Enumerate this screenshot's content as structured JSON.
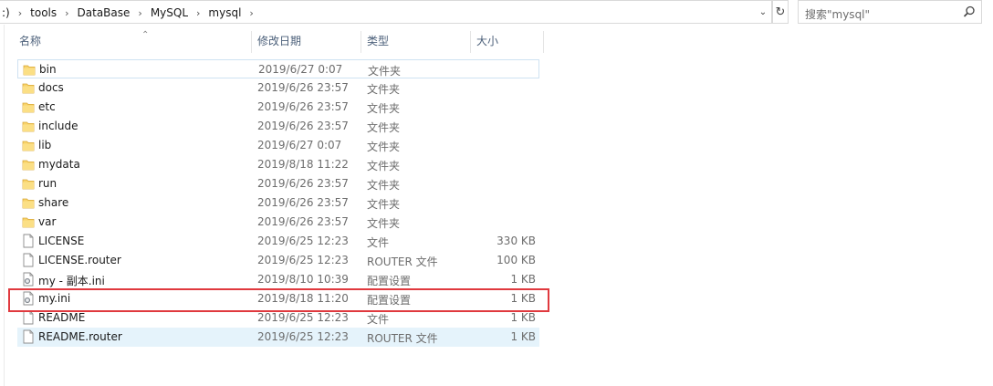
{
  "breadcrumb": [
    ":)",
    "tools",
    "DataBase",
    "MySQL",
    "mysql"
  ],
  "search": {
    "placeholder": "搜索\"mysql\""
  },
  "columns": {
    "name": "名称",
    "date": "修改日期",
    "type": "类型",
    "size": "大小"
  },
  "files": [
    {
      "name": "bin",
      "date": "2019/6/27 0:07",
      "type": "文件夹",
      "size": "",
      "icon": "folder-icon",
      "state": "selected"
    },
    {
      "name": "docs",
      "date": "2019/6/26 23:57",
      "type": "文件夹",
      "size": "",
      "icon": "folder-icon"
    },
    {
      "name": "etc",
      "date": "2019/6/26 23:57",
      "type": "文件夹",
      "size": "",
      "icon": "folder-icon"
    },
    {
      "name": "include",
      "date": "2019/6/26 23:57",
      "type": "文件夹",
      "size": "",
      "icon": "folder-icon"
    },
    {
      "name": "lib",
      "date": "2019/6/27 0:07",
      "type": "文件夹",
      "size": "",
      "icon": "folder-icon"
    },
    {
      "name": "mydata",
      "date": "2019/8/18 11:22",
      "type": "文件夹",
      "size": "",
      "icon": "folder-icon"
    },
    {
      "name": "run",
      "date": "2019/6/26 23:57",
      "type": "文件夹",
      "size": "",
      "icon": "folder-icon"
    },
    {
      "name": "share",
      "date": "2019/6/26 23:57",
      "type": "文件夹",
      "size": "",
      "icon": "folder-icon"
    },
    {
      "name": "var",
      "date": "2019/6/26 23:57",
      "type": "文件夹",
      "size": "",
      "icon": "folder-icon"
    },
    {
      "name": "LICENSE",
      "date": "2019/6/25 12:23",
      "type": "文件",
      "size": "330 KB",
      "icon": "file-icon"
    },
    {
      "name": "LICENSE.router",
      "date": "2019/6/25 12:23",
      "type": "ROUTER 文件",
      "size": "100 KB",
      "icon": "file-icon"
    },
    {
      "name": "my - 副本.ini",
      "date": "2019/8/10 10:39",
      "type": "配置设置",
      "size": "1 KB",
      "icon": "settings-file-icon"
    },
    {
      "name": "my.ini",
      "date": "2019/8/18 11:20",
      "type": "配置设置",
      "size": "1 KB",
      "icon": "settings-file-icon"
    },
    {
      "name": "README",
      "date": "2019/6/25 12:23",
      "type": "文件",
      "size": "1 KB",
      "icon": "file-icon"
    },
    {
      "name": "README.router",
      "date": "2019/6/25 12:23",
      "type": "ROUTER 文件",
      "size": "1 KB",
      "icon": "file-icon",
      "state": "hover"
    }
  ],
  "annotation": {
    "highlighted_file": "my.ini",
    "color": "#e0393e"
  }
}
